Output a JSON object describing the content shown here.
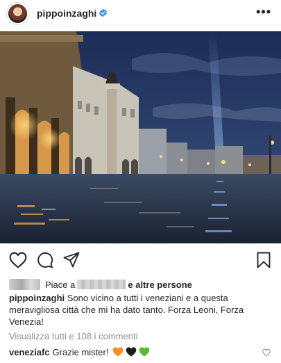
{
  "post": {
    "username": "pippoinzaghi",
    "verified": true
  },
  "likes": {
    "prefix": "Piace a",
    "suffix": "e altre persone"
  },
  "caption": {
    "username": "pippoinzaghi",
    "text": "Sono vicino a tutti i veneziani e a questa meravigliosa città che mi ha dato tanto. Forza Leoni, Forza Venezia!"
  },
  "comments_link": "Visualizza tutti e 108 i commenti",
  "comment": {
    "username": "veneziafc",
    "text": "Grazie mister!",
    "emojis": [
      "orange-heart",
      "black-heart",
      "green-heart"
    ]
  },
  "colors": {
    "text": "#262626",
    "muted": "#8e8e8e",
    "verified": "#3897f0",
    "orange_heart": "#f5901e",
    "black_heart": "#1c1c1c",
    "green_heart": "#5fb832"
  }
}
